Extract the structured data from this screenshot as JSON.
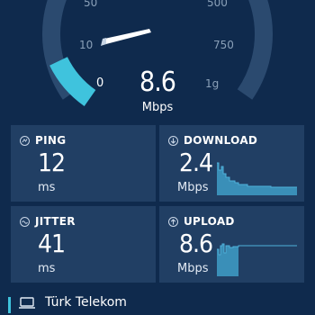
{
  "gauge": {
    "ticks": {
      "t50": "50",
      "t500": "500",
      "t10": "10",
      "t750": "750",
      "t0": "0",
      "t1g": "1g"
    },
    "value": "8.6",
    "unit": "Mbps",
    "level_fraction": 0.28,
    "colors": {
      "track": "#2b4a6f",
      "fill": "#3fc3dd",
      "needle": "#ffffff"
    }
  },
  "cards": {
    "ping": {
      "label": "PING",
      "value": "12",
      "unit": "ms",
      "icon": "ping-icon"
    },
    "download": {
      "label": "DOWNLOAD",
      "value": "2.4",
      "unit": "Mbps",
      "icon": "download-icon"
    },
    "jitter": {
      "label": "JITTER",
      "value": "41",
      "unit": "ms",
      "icon": "jitter-icon"
    },
    "upload": {
      "label": "UPLOAD",
      "value": "8.6",
      "unit": "Mbps",
      "icon": "upload-icon"
    }
  },
  "provider": {
    "name": "Türk Telekom",
    "icon": "laptop-icon",
    "accent": "#3fc3dd"
  }
}
